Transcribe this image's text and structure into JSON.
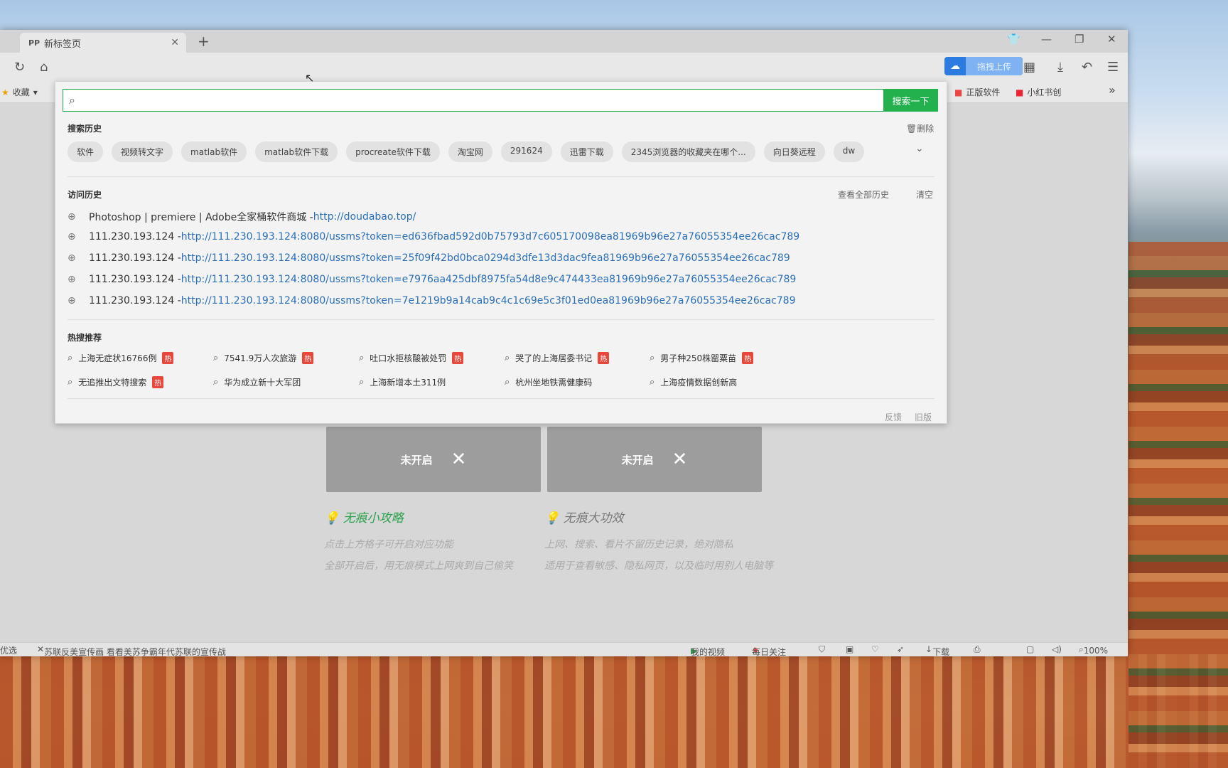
{
  "tab": {
    "title": "新标签页"
  },
  "bookmarks": {
    "favorites": "收藏",
    "right1": "正版软件",
    "right2": "小红书创"
  },
  "ext": {
    "upload_label": "拖拽上传"
  },
  "search": {
    "value": "",
    "button": "搜索一下"
  },
  "search_history": {
    "title": "搜索历史",
    "delete": "删除",
    "items": [
      "软件",
      "视频转文字",
      "matlab软件",
      "matlab软件下载",
      "procreate软件下载",
      "淘宝网",
      "291624",
      "迅雷下载",
      "2345浏览器的收藏夹在哪个...",
      "向日葵远程",
      "dw"
    ]
  },
  "visit_history": {
    "title": "访问历史",
    "view_all": "查看全部历史",
    "clear": "清空",
    "items": [
      {
        "title": "Photoshop | premiere | Adobe全家桶软件商城 - ",
        "url": "http://doudabao.top/"
      },
      {
        "title": "111.230.193.124 - ",
        "url": "http://111.230.193.124:8080/ussms?token=ed636fbad592d0b75793d7c605170098ea81969b96e27a76055354ee26cac789"
      },
      {
        "title": "111.230.193.124 - ",
        "url": "http://111.230.193.124:8080/ussms?token=25f09f42bd0bca0294d3dfe13d3dac9fea81969b96e27a76055354ee26cac789"
      },
      {
        "title": "111.230.193.124 - ",
        "url": "http://111.230.193.124:8080/ussms?token=e7976aa425dbf8975fa54d8e9c474433ea81969b96e27a76055354ee26cac789"
      },
      {
        "title": "111.230.193.124 - ",
        "url": "http://111.230.193.124:8080/ussms?token=7e1219b9a14cab9c4c1c69e5c3f01ed0ea81969b96e27a76055354ee26cac789"
      }
    ]
  },
  "hot": {
    "title": "热搜推荐",
    "badge": "热",
    "row1": [
      {
        "text": "上海无症状16766例",
        "hot": true
      },
      {
        "text": "7541.9万人次旅游",
        "hot": true
      },
      {
        "text": "吐口水拒核酸被处罚",
        "hot": true
      },
      {
        "text": "哭了的上海居委书记",
        "hot": true
      },
      {
        "text": "男子种250株罂粟苗",
        "hot": true
      }
    ],
    "row2": [
      {
        "text": "无追推出文特搜索",
        "hot": true
      },
      {
        "text": "华为成立新十大军团",
        "hot": false
      },
      {
        "text": "上海新增本土311例",
        "hot": false
      },
      {
        "text": "杭州坐地铁需健康码",
        "hot": false
      },
      {
        "text": "上海疫情数据创新高",
        "hot": false
      }
    ]
  },
  "footer": {
    "feedback": "反馈",
    "old": "旧版"
  },
  "cards": [
    {
      "label": "未开启"
    },
    {
      "label": "未开启"
    }
  ],
  "tips": {
    "left_title": "无痕小攻略",
    "left_lines": [
      "点击上方格子可开启对应功能",
      "全部开启后，用无痕模式上网爽到自己偷笑"
    ],
    "right_title": "无痕大功效",
    "right_lines": [
      "上网、搜索、看片不留历史记录，绝对隐私",
      "适用于查看敏感、隐私网页，以及临时用别人电脑等"
    ]
  },
  "statusbar": {
    "left0": "优选",
    "news": "苏联反美宣传画 看看美苏争霸年代苏联的宣传战",
    "my_video": "我的视频",
    "daily": "每日关注",
    "download": "下载",
    "zoom": "100%"
  }
}
